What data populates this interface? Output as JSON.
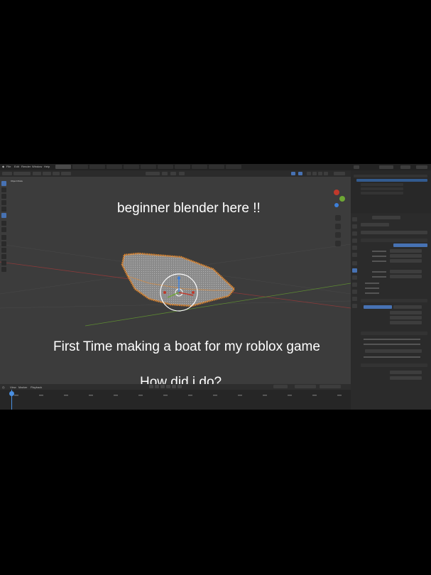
{
  "app": {
    "menu": [
      "File",
      "Edit",
      "Render",
      "Window",
      "Help"
    ]
  },
  "viewport": {
    "mode_label": "Object Mode",
    "captions": {
      "heading": "beginner blender here !!",
      "description": "First Time making a boat for my roblox game",
      "question": "How did i do?"
    }
  },
  "timeline": {
    "menu": [
      "View",
      "Marker",
      "Playback"
    ]
  },
  "colors": {
    "accent": "#4772b3",
    "mesh_selection": "#e8892b",
    "axis_x": "#c0392b",
    "axis_y": "#6ea734",
    "axis_z": "#3d7fd9"
  },
  "icons": [
    "gizmo-icon",
    "move-icon",
    "rotate-icon",
    "scale-icon",
    "camera-icon",
    "grid-icon"
  ]
}
